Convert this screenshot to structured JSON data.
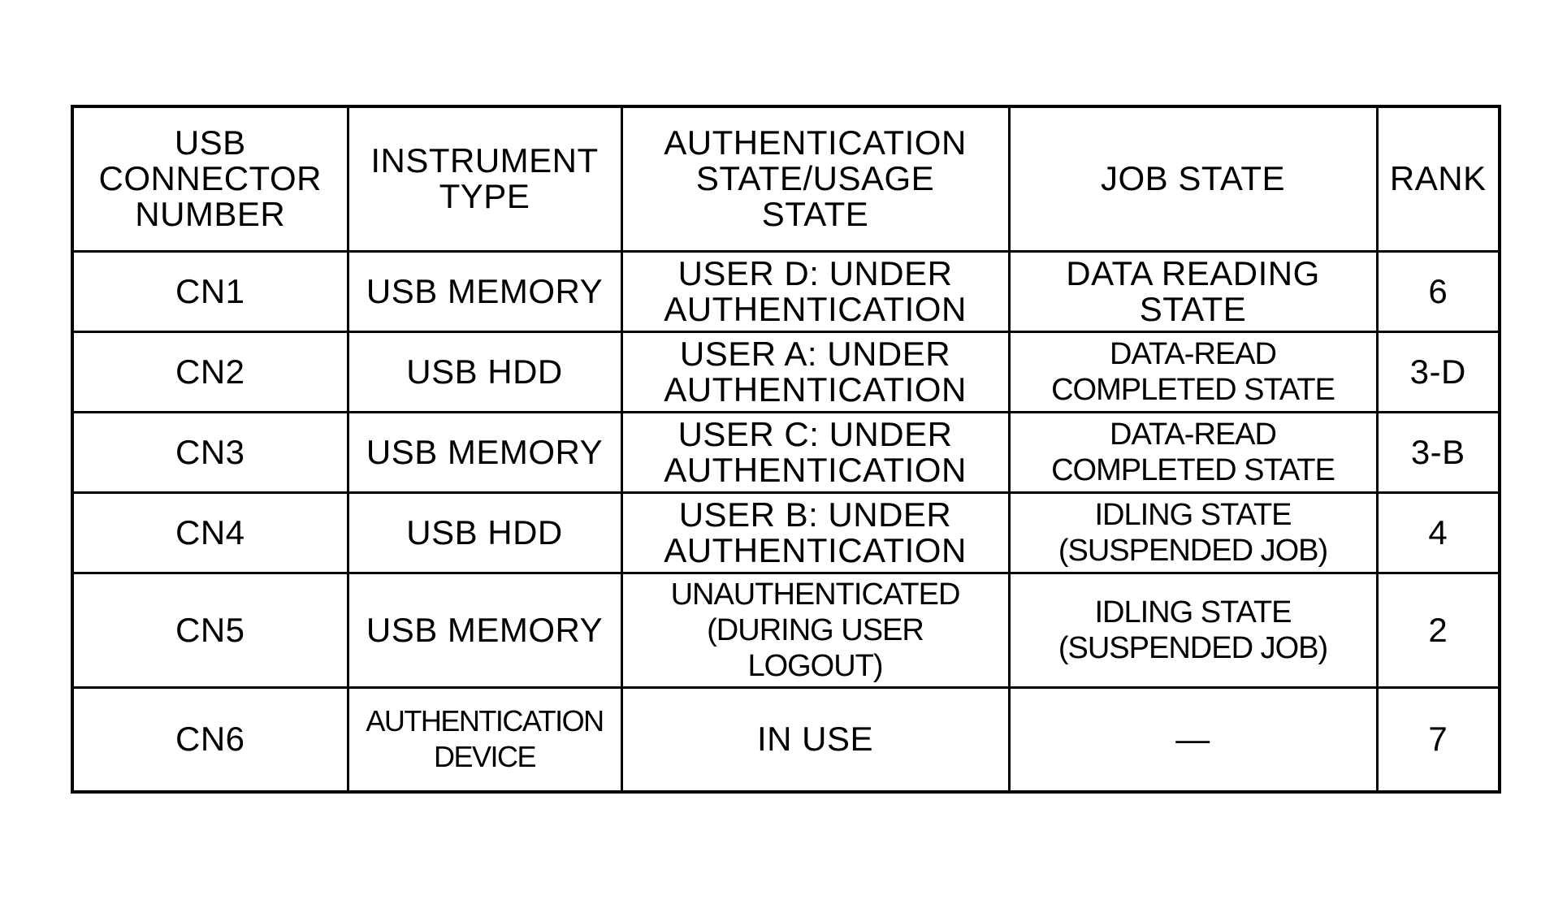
{
  "table": {
    "headers": [
      "USB\nCONNECTOR\nNUMBER",
      "INSTRUMENT\nTYPE",
      "AUTHENTICATION\nSTATE/USAGE\nSTATE",
      "JOB STATE",
      "RANK"
    ],
    "rows": [
      {
        "connector": "CN1",
        "instrument": "USB MEMORY",
        "auth_state": "USER D: UNDER\nAUTHENTICATION",
        "job_state": "DATA READING\nSTATE",
        "rank": "6"
      },
      {
        "connector": "CN2",
        "instrument": "USB HDD",
        "auth_state": "USER A: UNDER\nAUTHENTICATION",
        "job_state": "DATA-READ\nCOMPLETED STATE",
        "rank": "3-D"
      },
      {
        "connector": "CN3",
        "instrument": "USB MEMORY",
        "auth_state": "USER C: UNDER\nAUTHENTICATION",
        "job_state": "DATA-READ\nCOMPLETED STATE",
        "rank": "3-B"
      },
      {
        "connector": "CN4",
        "instrument": "USB HDD",
        "auth_state": "USER B: UNDER\nAUTHENTICATION",
        "job_state": "IDLING STATE\n(SUSPENDED JOB)",
        "rank": "4"
      },
      {
        "connector": "CN5",
        "instrument": "USB MEMORY",
        "auth_state": "UNAUTHENTICATED\n(DURING USER\nLOGOUT)",
        "job_state": "IDLING STATE\n(SUSPENDED JOB)",
        "rank": "2"
      },
      {
        "connector": "CN6",
        "instrument": "AUTHENTICATION\nDEVICE",
        "auth_state": "IN USE",
        "job_state": "—",
        "rank": "7"
      }
    ]
  }
}
